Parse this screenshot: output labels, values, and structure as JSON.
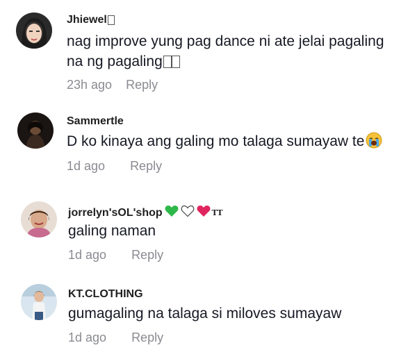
{
  "comments": [
    {
      "username": "Jhiewel",
      "text": "nag improve yung pag dance ni ate jelai pagaling",
      "text_line2": "na ng pagaling",
      "time": "23h ago",
      "reply_label": "Reply"
    },
    {
      "username": "Sammertle",
      "text": "D ko kinaya ang galing mo talaga sumayaw te",
      "time": "1d ago",
      "reply_label": "Reply"
    },
    {
      "username": "jorrelyn'sOL'shop",
      "username_suffix_icons": [
        "green-heart-icon",
        "white-heart-icon",
        "red-heart-icon",
        "tt-icon"
      ],
      "text": "galing naman",
      "time": "1d ago",
      "reply_label": "Reply"
    },
    {
      "username": "KT.CLOTHING",
      "text": "gumagaling na talaga si miloves sumayaw",
      "time": "1d ago",
      "reply_label": "Reply"
    }
  ],
  "colors": {
    "text": "#161823",
    "meta": "#8a8b91",
    "green_heart": "#2fb84a",
    "red_heart": "#e0245e"
  }
}
